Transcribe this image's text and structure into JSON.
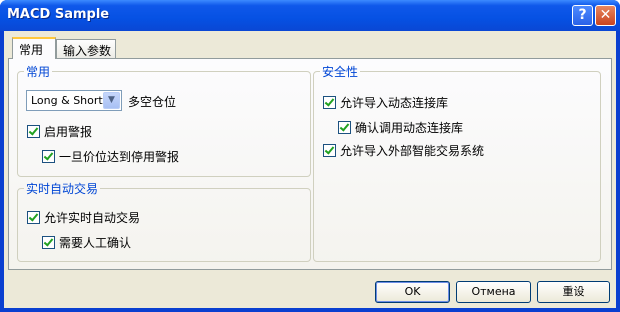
{
  "window": {
    "title": "MACD Sample",
    "help_label": "?",
    "close_label": "✕"
  },
  "tabs": [
    {
      "label": "常用"
    },
    {
      "label": "输入参数"
    }
  ],
  "general_group": {
    "legend": "常用",
    "position_select": {
      "value": "Long & Short",
      "label": "多空仓位"
    },
    "enable_alerts": {
      "label": "启用警报",
      "checked": true
    },
    "disable_alert_once_hit": {
      "label": "一旦价位达到停用警报",
      "checked": true
    }
  },
  "live_trading_group": {
    "legend": "实时自动交易",
    "allow_live_trading": {
      "label": "允许实时自动交易",
      "checked": true
    },
    "manual_confirmation": {
      "label": "需要人工确认",
      "checked": true
    }
  },
  "safety_group": {
    "legend": "安全性",
    "allow_dll_imports": {
      "label": "允许导入动态连接库",
      "checked": true
    },
    "confirm_dll_calls": {
      "label": "确认调用动态连接库",
      "checked": true
    },
    "allow_external_experts": {
      "label": "允许导入外部智能交易系统",
      "checked": true
    }
  },
  "buttons": {
    "ok": "OK",
    "cancel": "Отмена",
    "reset": "重设"
  }
}
